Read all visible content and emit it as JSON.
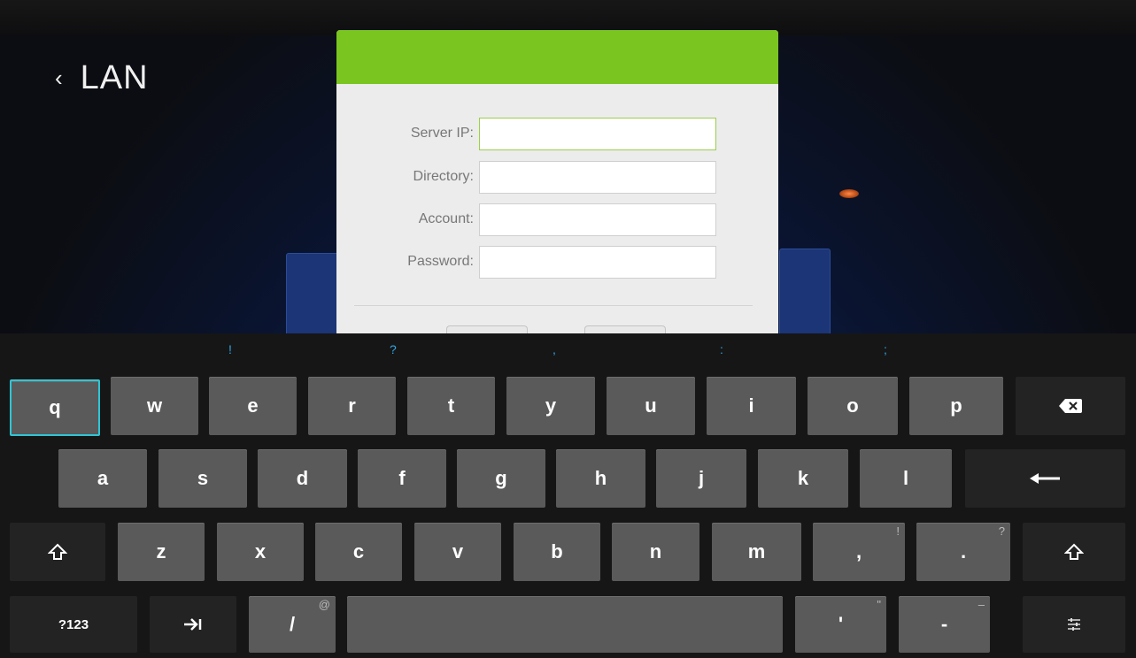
{
  "header": {
    "back_icon": "‹",
    "title": "LAN"
  },
  "dialog": {
    "accent_color": "#7ac520",
    "fields": [
      {
        "label": "Server IP:",
        "value": "",
        "placeholder": ""
      },
      {
        "label": "Directory:",
        "value": "",
        "placeholder": ""
      },
      {
        "label": "Account:",
        "value": "",
        "placeholder": ""
      },
      {
        "label": "Password:",
        "value": "",
        "placeholder": ""
      }
    ]
  },
  "keyboard": {
    "hints": [
      "!",
      "?",
      ",",
      ":",
      ";"
    ],
    "row1": [
      "q",
      "w",
      "e",
      "r",
      "t",
      "y",
      "u",
      "i",
      "o",
      "p"
    ],
    "row2": [
      "a",
      "s",
      "d",
      "f",
      "g",
      "h",
      "j",
      "k",
      "l"
    ],
    "row3": [
      "z",
      "x",
      "c",
      "v",
      "b",
      "n",
      "m",
      ",",
      "."
    ],
    "row3_alt": {
      "comma": "!",
      "period": "?"
    },
    "row4": {
      "symbols": "?123",
      "slash": "/",
      "slash_alt": "@",
      "apostrophe": "'",
      "apostrophe_alt": "\"",
      "dash": "-",
      "dash_alt": "–"
    },
    "icons": {
      "backspace": "backspace-icon",
      "enter": "enter-icon",
      "shift": "shift-icon",
      "tab": "tab-icon",
      "settings": "keyboard-settings-icon"
    },
    "selected_key": "q",
    "selection_color": "#2fc6d4"
  }
}
